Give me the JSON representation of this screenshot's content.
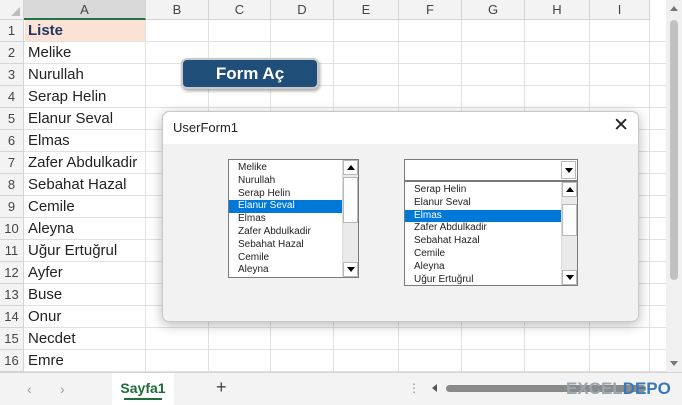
{
  "columns": [
    "A",
    "B",
    "C",
    "D",
    "E",
    "F",
    "G",
    "H",
    "I"
  ],
  "selected_column": "A",
  "rows": [
    "1",
    "2",
    "3",
    "4",
    "5",
    "6",
    "7",
    "8",
    "9",
    "10",
    "11",
    "12",
    "13",
    "14",
    "15",
    "16"
  ],
  "column_a": [
    "Liste",
    "Melike",
    "Nurullah",
    "Serap Helin",
    "Elanur Seval",
    "Elmas",
    "Zafer Abdulkadir",
    "Sebahat Hazal",
    "Cemile",
    "Aleyna",
    "Uğur Ertuğrul",
    "Ayfer",
    "Buse",
    "Onur",
    "Necdet",
    "Emre"
  ],
  "button": {
    "label": "Form Aç",
    "color": "#1f4e79"
  },
  "userform": {
    "title": "UserForm1",
    "close_glyph": "✕",
    "listbox": {
      "items": [
        "Melike",
        "Nurullah",
        "Serap Helin",
        "Elanur Seval",
        "Elmas",
        "Zafer Abdulkadir",
        "Sebahat Hazal",
        "Cemile",
        "Aleyna"
      ],
      "selected": "Elanur Seval"
    },
    "combobox": {
      "value": "",
      "dropdown_items": [
        "Serap Helin",
        "Elanur Seval",
        "Elmas",
        "Zafer Abdulkadir",
        "Sebahat Hazal",
        "Cemile",
        "Aleyna",
        "Uğur Ertuğrul"
      ],
      "selected": "Elmas"
    }
  },
  "tabs": {
    "prev_glyph": "‹",
    "next_glyph": "›",
    "active_sheet": "Sayfa1",
    "add_glyph": "+",
    "dots": "⋮"
  },
  "watermark": {
    "part1": "EXCEL",
    "part2": "DEPO"
  },
  "colors": {
    "accent": "#217346",
    "selection": "#0078d7",
    "header_fill": "#fbe2d5"
  }
}
